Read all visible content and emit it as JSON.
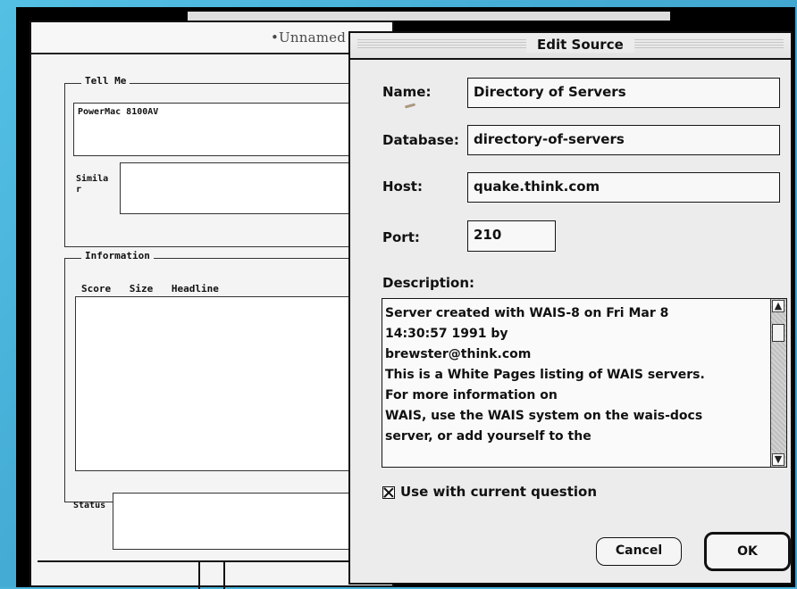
{
  "background_window": {
    "title": "•Unnamed",
    "tell_me": {
      "label": "Tell Me",
      "query_value": "PowerMac 8100AV",
      "similar_label": "Simila r"
    },
    "information": {
      "label": "Information",
      "columns": [
        "Score",
        "Size",
        "Headline"
      ]
    },
    "status_label": "Status"
  },
  "dialog": {
    "title": "Edit Source",
    "fields": {
      "name_label": "Name:",
      "name_value": "Directory of Servers",
      "database_label": "Database:",
      "database_value": "directory-of-servers",
      "host_label": "Host:",
      "host_value": "quake.think.com",
      "port_label": "Port:",
      "port_value": "210"
    },
    "description_label": "Description:",
    "description_lines": [
      "Server created with WAIS-8 on Fri Mar 8",
      "14:30:57 1991 by",
      " brewster@think.com",
      "This is a White Pages listing of WAIS servers.",
      "For more information on",
      "WAIS, use the WAIS system on the wais-docs",
      "server, or add yourself to the"
    ],
    "checkbox_label": "Use with current question",
    "checkbox_checked": true,
    "buttons": {
      "cancel": "Cancel",
      "ok": "OK"
    }
  },
  "colors": {
    "desktop": "#49b3d8",
    "window_bg": "#f4f4f4",
    "dialog_bg": "#ececec",
    "border": "#111111"
  },
  "icons": {
    "scroll_up": "arrow-up-icon",
    "scroll_down": "arrow-down-icon",
    "checkbox": "checked-box-icon"
  }
}
